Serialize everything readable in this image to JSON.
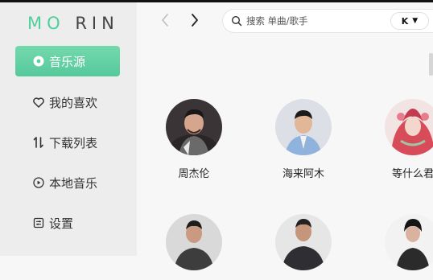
{
  "app": {
    "logo_main": "MO",
    "logo_tail": "RIN"
  },
  "sidebar": {
    "items": [
      {
        "label": "音乐源",
        "icon": "record-icon",
        "active": true
      },
      {
        "label": "我的喜欢",
        "icon": "heart-icon",
        "active": false
      },
      {
        "label": "下载列表",
        "icon": "sort-arrows-icon",
        "active": false
      },
      {
        "label": "本地音乐",
        "icon": "play-circle-icon",
        "active": false
      },
      {
        "label": "设置",
        "icon": "settings-icon",
        "active": false
      }
    ]
  },
  "header": {
    "search_placeholder": "搜索 单曲/歌手",
    "source_label": "K",
    "accent_color": "#5ccf9f"
  },
  "artists": [
    {
      "name": "周杰伦"
    },
    {
      "name": "海来阿木"
    },
    {
      "name": "等什么君"
    },
    {
      "name": ""
    },
    {
      "name": ""
    },
    {
      "name": ""
    }
  ]
}
